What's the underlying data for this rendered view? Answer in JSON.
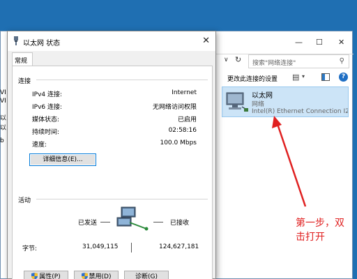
{
  "background_window": {
    "search_placeholder": "搜索\"网络连接\"",
    "toolbar": {
      "change_settings_label": "更改此连接的设置"
    },
    "adapter": {
      "name": "以太网",
      "network": "网络",
      "device": "Intel(R) Ethernet Connection I2..."
    },
    "left_fragments": [
      "VI",
      "VI",
      "以",
      "以",
      "b"
    ]
  },
  "annotation": "第一步，双击打开",
  "dialog": {
    "title": "以太网 状态",
    "tab": "常规",
    "connection": {
      "group_label": "连接",
      "rows": [
        {
          "label": "IPv4 连接:",
          "value": "Internet"
        },
        {
          "label": "IPv6 连接:",
          "value": "无网络访问权限"
        },
        {
          "label": "媒体状态:",
          "value": "已启用"
        },
        {
          "label": "持续时间:",
          "value": "02:58:16"
        },
        {
          "label": "速度:",
          "value": "100.0 Mbps"
        }
      ],
      "details_button": "详细信息(E)..."
    },
    "activity": {
      "group_label": "活动",
      "sent_label": "已发送",
      "received_label": "已接收",
      "bytes_label": "字节:",
      "bytes_sent": "31,049,115",
      "bytes_received": "124,627,181"
    },
    "buttons": {
      "properties": "属性(P)",
      "disable": "禁用(D)",
      "diagnose": "诊断(G)"
    }
  },
  "colors": {
    "desktop": "#1f6fb2",
    "selection": "#cce4f7",
    "annotation": "#e02020",
    "accent": "#0078d7"
  }
}
